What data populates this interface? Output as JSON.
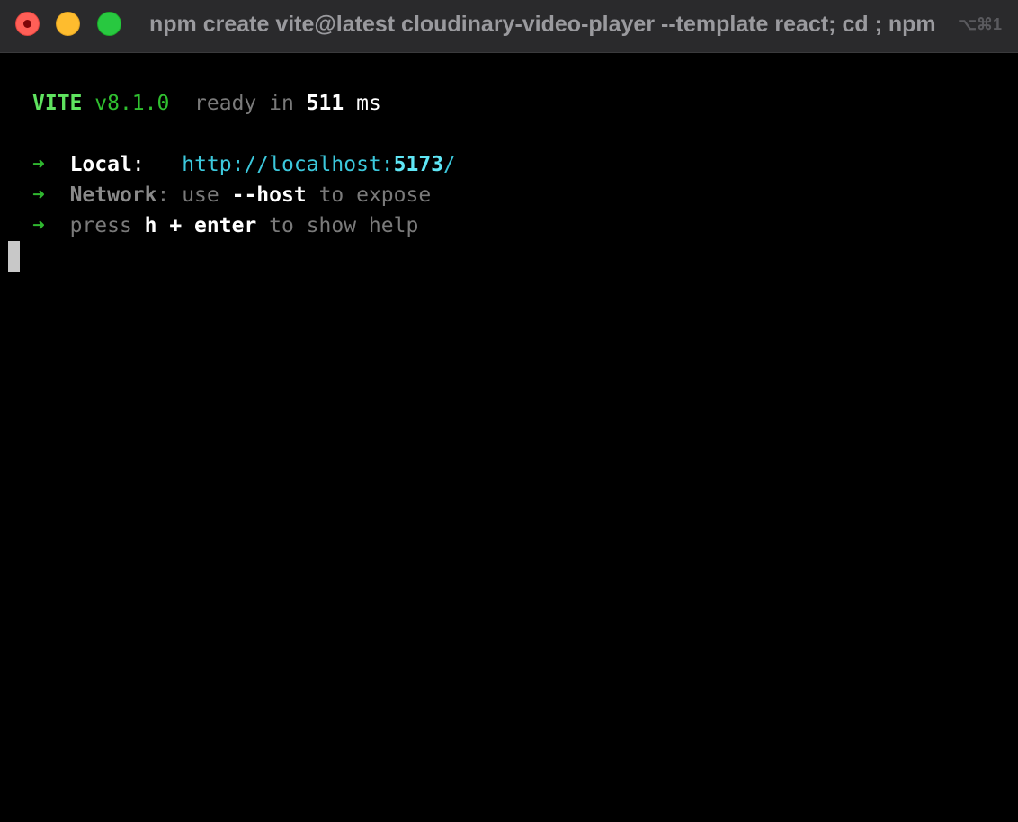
{
  "window": {
    "title": "npm create vite@latest cloudinary-video-player --template react; cd ; npm",
    "shortcut": "⌥⌘1",
    "colors": {
      "close": "#ff5f57",
      "minimize": "#febc2e",
      "zoom": "#28c840"
    }
  },
  "terminal": {
    "banner": {
      "name": "VITE",
      "version": "v8.1.0",
      "ready_text": "ready in",
      "time_value": "511",
      "time_unit": "ms"
    },
    "local": {
      "arrow": "➜",
      "label": "Local",
      "colon": ":",
      "url_prefix": "http://localhost:",
      "port": "5173",
      "url_suffix": "/"
    },
    "network": {
      "arrow": "➜",
      "label": "Network",
      "text_before": ": use",
      "flag": "--host",
      "text_after": "to expose"
    },
    "help": {
      "arrow": "➜",
      "text_before": "press",
      "key": "h + enter",
      "text_after": "to show help"
    }
  }
}
